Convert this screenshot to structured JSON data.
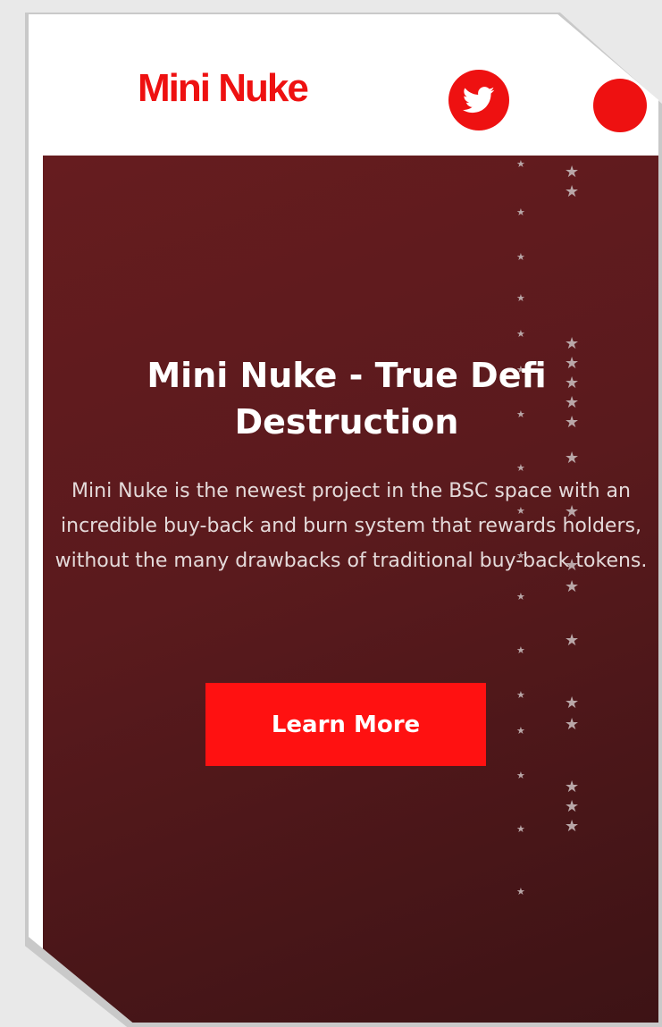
{
  "header": {
    "logo_text": "Mini Nuke",
    "icons": [
      "twitter-icon",
      "telegram-icon"
    ]
  },
  "hero": {
    "title": "Mini Nuke - True Defi Destruction",
    "description": "Mini Nuke is the newest project in the BSC space with an incredible buy-back and burn system that rewards holders, without the many drawbacks of traditional buy-back tokens.",
    "button_label": "Learn More"
  },
  "colors": {
    "brand_red": "#ee1111",
    "hero_bg": "#5a1a1d",
    "button_bg": "#ff1111"
  }
}
